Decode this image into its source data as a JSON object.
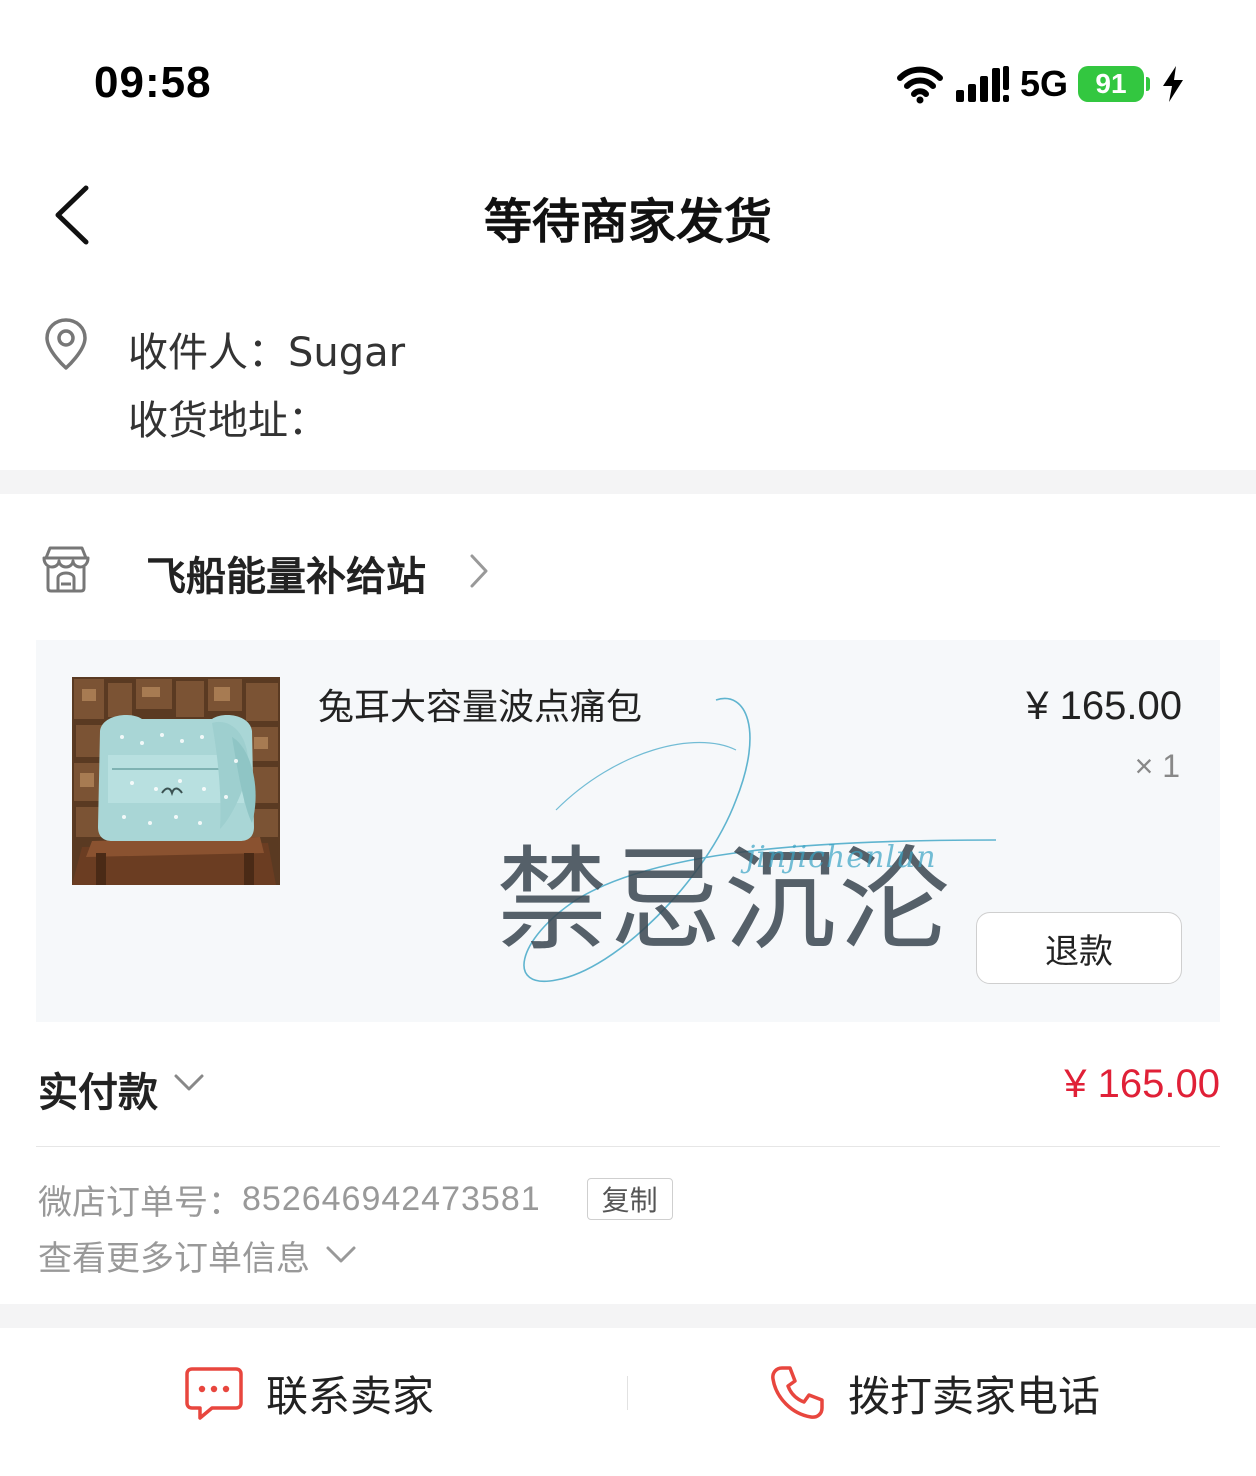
{
  "status_bar": {
    "time": "09:58",
    "network": "5G",
    "battery": "91",
    "battery_color": "#33c740"
  },
  "nav": {
    "title": "等待商家发货",
    "back_icon": "chevron-left-icon"
  },
  "address": {
    "recipient_label": "收件人：",
    "recipient_name": "Sugar",
    "address_label": "收货地址："
  },
  "shop": {
    "name": "飞船能量补给站",
    "icon": "store-icon"
  },
  "product": {
    "title": "兔耳大容量波点痛包",
    "price": "¥ 165.00",
    "quantity": "× 1",
    "refund_label": "退款",
    "watermark": "禁忌沉沦",
    "watermark_script": "jinjichenlun"
  },
  "payment": {
    "label": "实付款",
    "amount": "¥ 165.00",
    "amount_color": "#e02037"
  },
  "order": {
    "label": "微店订单号：",
    "number": "852646942473581",
    "copy_label": "复制",
    "more_label": "查看更多订单信息"
  },
  "bottom": {
    "contact_label": "联系卖家",
    "call_label": "拨打卖家电话",
    "icon_color": "#e8463e"
  }
}
